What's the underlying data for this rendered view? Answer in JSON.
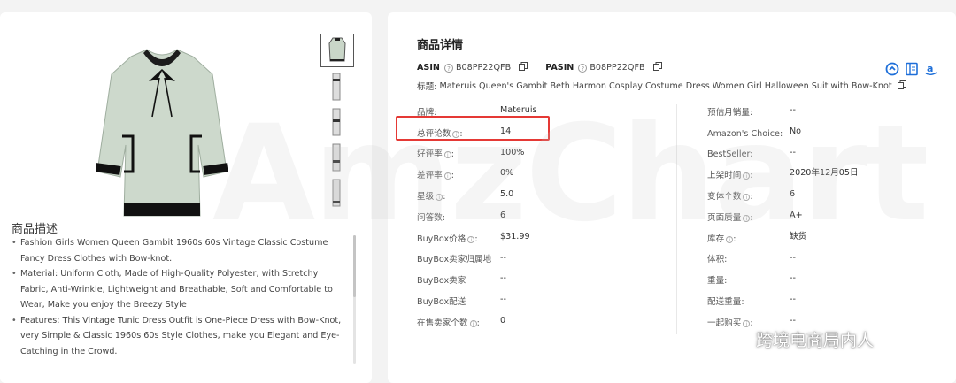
{
  "product": {
    "desc_title": "商品描述",
    "bullets": [
      "Fashion Girls Women Queen Gambit 1960s 60s Vintage Classic Costume Fancy Dress Clothes with Bow-knot.",
      "Material: Uniform Cloth, Made of High-Quality Polyester, with Stretchy Fabric, Anti-Wrinkle, Lightweight and Breathable, Soft and Comfortable to Wear, Make you enjoy the Breezy Style",
      "Features: This Vintage Tunic Dress Outfit is One-Piece Dress with Bow-Knot, very Simple & Classic 1960s 60s Style Clothes, make you Elegant and Eye-Catching in the Crowd."
    ]
  },
  "details": {
    "title": "商品详情",
    "asin_label": "ASIN",
    "asin": "B08PP22QFB",
    "pasin_label": "PASIN",
    "pasin": "B08PP22QFB",
    "title_line_label": "标题:",
    "title_line": "Materuis Queen's Gambit Beth Harmon Cosplay Costume Dress Women Girl Halloween Suit with Bow-Knot",
    "left_fields": [
      {
        "label": "品牌:",
        "value": "Materuis"
      },
      {
        "label": "总评论数",
        "value": "14"
      },
      {
        "label": "好评率",
        "value": "100%"
      },
      {
        "label": "差评率",
        "value": "0%"
      },
      {
        "label": "星级",
        "value": "5.0"
      },
      {
        "label": "问答数:",
        "value": "6"
      },
      {
        "label": "BuyBox价格",
        "value": "$31.99"
      },
      {
        "label": "BuyBox卖家归属地",
        "value": "--"
      },
      {
        "label": "BuyBox卖家",
        "value": "--"
      },
      {
        "label": "BuyBox配送",
        "value": "--"
      },
      {
        "label": "在售卖家个数",
        "value": "0"
      }
    ],
    "right_fields": [
      {
        "label": "预估月销量:",
        "value": "--"
      },
      {
        "label": "Amazon's Choice:",
        "value": "No"
      },
      {
        "label": "BestSeller:",
        "value": "--"
      },
      {
        "label": "上架时间",
        "value": "2020年12月05日"
      },
      {
        "label": "变体个数",
        "value": "6"
      },
      {
        "label": "页面质量",
        "value": "A+"
      },
      {
        "label": "库存",
        "value": "缺货"
      },
      {
        "label": "体积:",
        "value": "--"
      },
      {
        "label": "重量:",
        "value": "--"
      },
      {
        "label": "配送重量:",
        "value": "--"
      },
      {
        "label": "一起购买",
        "value": "--"
      }
    ]
  },
  "watermark": {
    "text": "AmzChart",
    "wechat": "跨境电商局内人"
  },
  "colors": {
    "highlight": "#e53935",
    "icon_blue": "#1e6fd9",
    "dress": "#c9d6c8"
  }
}
